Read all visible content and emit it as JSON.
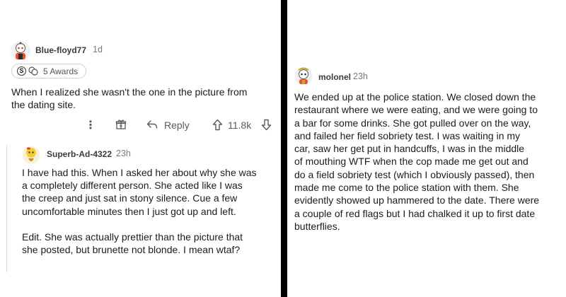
{
  "left": {
    "comment": {
      "username": "Blue-floyd77",
      "age": "1d",
      "awards_label": "5 Awards",
      "text_lines": [
        "When I realized she wasn't the one in the picture from",
        "the dating site."
      ],
      "reply_label": "Reply",
      "score": "11.8k"
    },
    "reply": {
      "username": "Superb-Ad-4322",
      "age": "23h",
      "text_lines": [
        "I have had this. When I asked her about why she was",
        "a completely different person. She acted like I was",
        "the creep and just sat in stony silence. Cue a few",
        "uncomfortable minutes then I just got up and left.",
        "",
        "Edit. She was actually prettier than the picture that",
        "she posted, but brunette not blonde. I mean wtaf?"
      ]
    }
  },
  "right": {
    "comment": {
      "username": "molonel",
      "age": "23h",
      "text_lines": [
        "We ended up at the police station. We closed down the",
        "restaurant where we were eating, and we were going to",
        "a bar for some drinks. She got pulled over on the way,",
        "and failed her field sobriety test. I was waiting in my",
        "car, saw her get put in handcuffs, I was in the middle",
        "of mouthing WTF when the cop made me get out and",
        "do a field sobriety test (which I obviously passed), then",
        "made me come to the police station with them. She",
        "evidently showed up hammered to the date. There were",
        "a couple of red flags but I had chalked it up to first date",
        "butterflies."
      ]
    }
  },
  "icons": {
    "more": "more-options-icon",
    "award_box": "gift-box-icon",
    "reply": "reply-arrow-icon",
    "upvote": "upvote-arrow-icon",
    "downvote": "downvote-arrow-icon"
  },
  "colors": {
    "text": "#1c1c1c",
    "meta": "#7a7a7a",
    "divider": "#000000"
  }
}
